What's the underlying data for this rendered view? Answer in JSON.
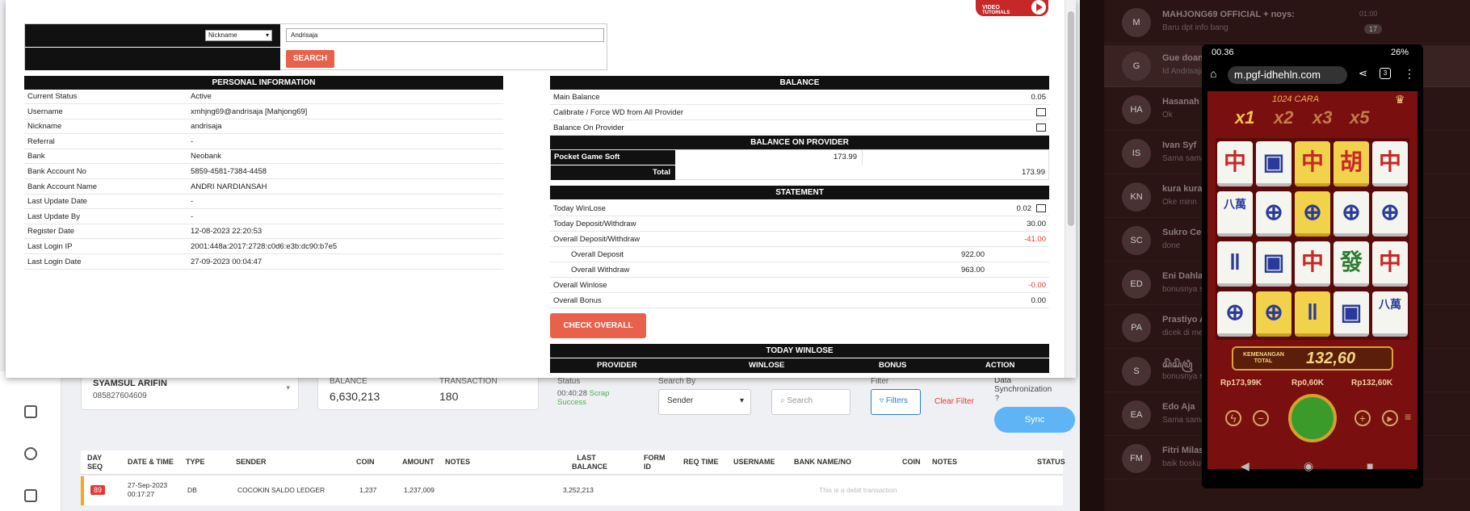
{
  "background_page": {
    "customer": {
      "name": "SYAMSUL ARIFIN",
      "phone": "085827604609"
    },
    "balance": {
      "label": "BALANCE",
      "value": "6,630,213"
    },
    "transaction": {
      "label": "TRANSACTION",
      "value": "180"
    },
    "status": {
      "label": "Status",
      "time": "00:40:28",
      "text": "Scrap",
      "state": "Success"
    },
    "search_by": {
      "label": "Search By",
      "value": "Sender"
    },
    "search_placeholder": "Search",
    "filter": {
      "label": "Filter",
      "button": "Filters",
      "clear": "Clear Filter"
    },
    "sync": {
      "label": "Data Synchronization",
      "button": "Sync"
    },
    "table": {
      "headers": [
        "DAY SEQ",
        "DATE & TIME",
        "TYPE",
        "SENDER",
        "COIN",
        "AMOUNT",
        "NOTES",
        "LAST BALANCE",
        "FORM ID",
        "REQ TIME",
        "USERNAME",
        "BANK NAME/NO",
        "COIN",
        "NOTES",
        "STATUS"
      ],
      "rows": [
        {
          "seq": "89",
          "date": "27-Sep-2023",
          "time": "00:17:27",
          "type": "DB",
          "sender": "COCOKIN SALDO LEDGER",
          "coin": "1,237",
          "amount": "1,237,009",
          "last_balance": "3,252,213",
          "note": "This is a debit transaction"
        }
      ]
    }
  },
  "modal": {
    "video_badge": {
      "line1": "VIDEO",
      "line2": "TUTORIALS"
    },
    "search": {
      "field_select": "Nickname",
      "value": "Andrisaja",
      "button": "SEARCH"
    },
    "personal": {
      "title": "PERSONAL INFORMATION",
      "rows": [
        {
          "k": "Current Status",
          "v": "Active"
        },
        {
          "k": "Username",
          "v": "xmhjng69@andrisaja  [Mahjong69]"
        },
        {
          "k": "Nickname",
          "v": "andrisaja"
        },
        {
          "k": "Referral",
          "v": "-"
        },
        {
          "k": "Bank",
          "v": "Neobank"
        },
        {
          "k": "Bank Account No",
          "v": "5859-4581-7384-4458"
        },
        {
          "k": "Bank Account Name",
          "v": "ANDRI NARDIANSAH"
        },
        {
          "k": "Last Update Date",
          "v": "-"
        },
        {
          "k": "Last Update By",
          "v": "-"
        },
        {
          "k": "Register Date",
          "v": "12-08-2023 22:20:53"
        },
        {
          "k": "Last Login IP",
          "v": "2001:448a:2017:2728:c0d6:e3b:dc90:b7e5"
        },
        {
          "k": "Last Login Date",
          "v": "27-09-2023 00:04:47"
        }
      ]
    },
    "balance": {
      "title": "BALANCE",
      "main_label": "Main Balance",
      "main_value": "0.05",
      "calibrate_label": "Calibrate / Force WD from All Provider",
      "on_provider_label": "Balance On Provider",
      "provider_title": "BALANCE ON PROVIDER",
      "provider_name": "Pocket Game Soft",
      "provider_value": "173.99",
      "total_label": "Total",
      "total_value": "173.99"
    },
    "statement": {
      "title": "STATEMENT",
      "today_winlose_label": "Today WinLose",
      "today_winlose": "0.02",
      "today_dw_label": "Today Deposit/Withdraw",
      "today_dw": "30.00",
      "overall_dw_label": "Overall Deposit/Withdraw",
      "overall_dw": "-41.00",
      "overall_deposit_label": "Overall Deposit",
      "overall_deposit": "922.00",
      "overall_withdraw_label": "Overall Withdraw",
      "overall_withdraw": "963.00",
      "overall_winlose_label": "Overall Winlose",
      "overall_winlose": "-0.00",
      "overall_bonus_label": "Overall Bonus",
      "overall_bonus": "0.00",
      "check_button": "CHECK OVERALL"
    },
    "today_winlose": {
      "title": "TODAY WINLOSE",
      "columns": [
        "PROVIDER",
        "WINLOSE",
        "BONUS",
        "ACTION"
      ]
    }
  },
  "chat": {
    "items": [
      {
        "name": "MAHJONG69 OFFICIAL + noys:",
        "msg": "Baru dpt info bang",
        "time": "01:00",
        "count": "17",
        "initials": "M"
      },
      {
        "name": "Gue doank",
        "msg": "Id Andrisaja",
        "time": "",
        "count": "",
        "initials": "G"
      },
      {
        "name": "Hasanah Alfian",
        "msg": "Ok",
        "time": "",
        "count": "",
        "initials": "HA"
      },
      {
        "name": "Ivan Syf",
        "msg": "Sama sama bo",
        "time": "",
        "count": "",
        "initials": "IS"
      },
      {
        "name": "kura kura ninja",
        "msg": "Oke minn",
        "time": "",
        "count": "",
        "initials": "KN"
      },
      {
        "name": "Sukro Cebong",
        "msg": "done",
        "time": "",
        "count": "",
        "initials": "SC"
      },
      {
        "name": "Eni Dahlan",
        "msg": "bonusnya su",
        "time": "",
        "count": "",
        "initials": "ED"
      },
      {
        "name": "Prastiyo Ari",
        "msg": "dicek di menu",
        "time": "",
        "count": "",
        "initials": "PA"
      },
      {
        "name": "ꦱꦼꦱꦼꦥꦿꦶ",
        "msg": "bonusnya sud",
        "time": "",
        "count": "",
        "initials": "S"
      },
      {
        "name": "Edo Aja",
        "msg": "Sama sama bo",
        "time": "",
        "count": "",
        "initials": "EA"
      },
      {
        "name": "Fitri Milasari",
        "msg": "baik bosku",
        "time": "",
        "count": "",
        "initials": "FM"
      }
    ]
  },
  "phone": {
    "time": "00.36",
    "battery": "26%",
    "url": "m.pgf-idhehln.com",
    "tabs": "3",
    "game_title": "1024 CARA",
    "multipliers": [
      "x1",
      "x2",
      "x3",
      "x5"
    ],
    "total_label_1": "KEMENANGAN",
    "total_label_2": "TOTAL",
    "total_value": "132,60",
    "balances": [
      "Rp173,99K",
      "Rp0,60K",
      "Rp132,60K"
    ],
    "tiles": [
      "中",
      "▣",
      "中",
      "胡",
      "中",
      "八萬",
      "⊕",
      "⊕",
      "⊕",
      "⊕",
      "‖",
      "▣",
      "中",
      "發",
      "中",
      "⊕",
      "⊕",
      "‖",
      "▣",
      "八萬"
    ]
  }
}
